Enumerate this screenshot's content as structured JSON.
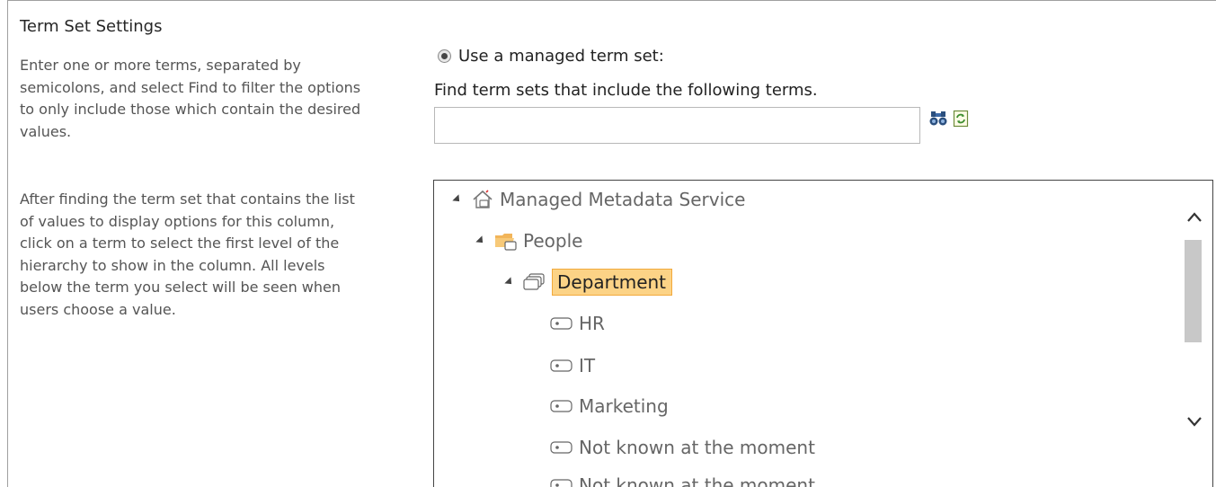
{
  "section": {
    "title": "Term Set Settings",
    "desc1": "Enter one or more terms, separated by semicolons, and select Find to filter the options to only include those which contain the desired values.",
    "desc2": "After finding the term set that contains the list of values to display options for this column, click on a term to select the first level of the hierarchy to show in the column. All levels below the term you select will be seen when users choose a value."
  },
  "managed": {
    "radio_label": "Use a managed term set:",
    "radio_selected": true,
    "find_label": "Find term sets that include the following terms.",
    "search_value": "",
    "find_icon": "binoculars-icon",
    "refresh_icon": "refresh-icon"
  },
  "tree": {
    "root": "Managed Metadata Service",
    "group": "People",
    "termset": "Department",
    "terms": [
      "HR",
      "IT",
      "Marketing",
      "Not known at the moment",
      "Not known at the moment"
    ]
  },
  "colors": {
    "selected_bg": "#fcd386",
    "selected_border": "#f2a93b"
  }
}
